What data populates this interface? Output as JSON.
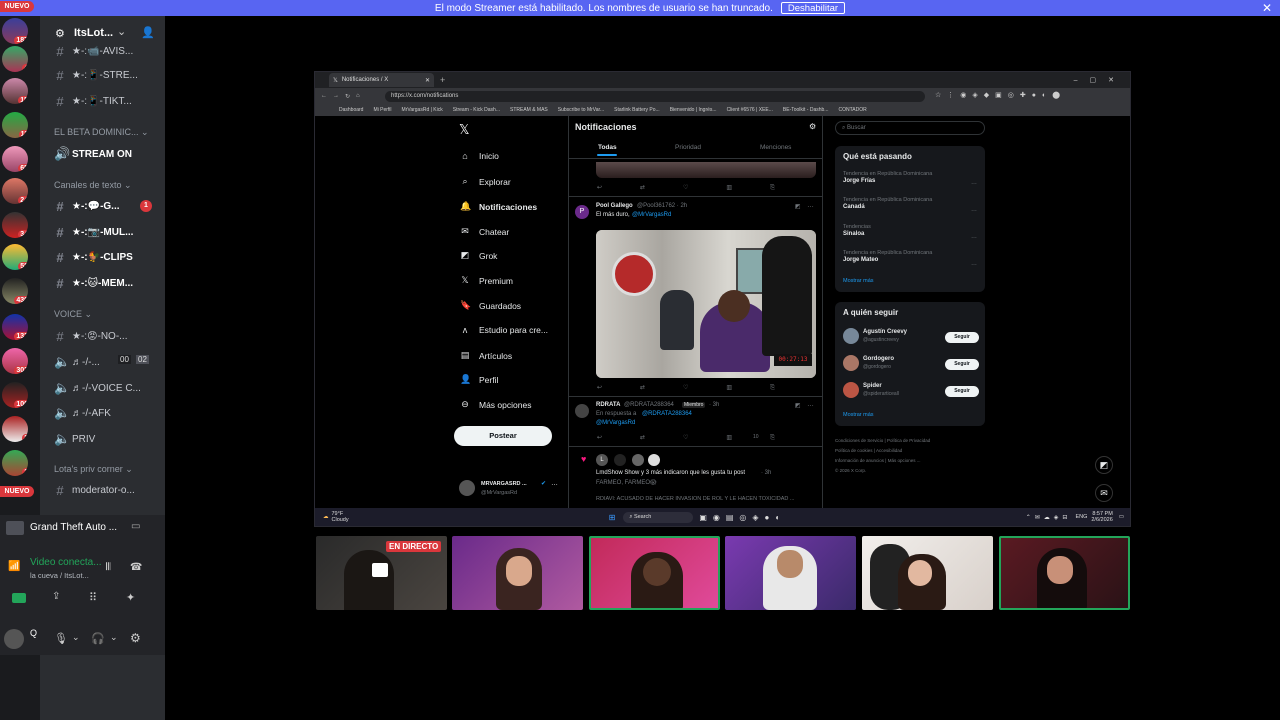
{
  "banner": {
    "text": "El modo Streamer está habilitado. Los nombres de usuario se han truncado.",
    "button": "Deshabilitar"
  },
  "server_rail": {
    "nuevo_top": "NUEVO",
    "nuevo_bottom": "NUEVO",
    "badges": [
      "187",
      "4",
      "15",
      "11",
      "65",
      "24",
      "34",
      "58",
      "430",
      "133",
      "303",
      "106",
      "2",
      "1"
    ]
  },
  "sidebar": {
    "server_name": "ItsLot...",
    "channels_top": [
      "★-:📹-AVIS...",
      "★-:📱-STRE...",
      "★-:📱-TIKT..."
    ],
    "category_beta": "EL BETA DOMINIC...",
    "stream_on": "STREAM ON",
    "category_text": "Canales de texto",
    "text_channels": [
      {
        "name": "★-:💬-G...",
        "badge": "1"
      },
      {
        "name": "★-:📷-MUL..."
      },
      {
        "name": "★-:🐓-CLIPS"
      },
      {
        "name": "★-:🐱-MEM..."
      }
    ],
    "category_voice": "VOICE",
    "voice_channels": [
      {
        "name": "★-:😡-NO-..."
      },
      {
        "name": "♬-/-...",
        "counts": [
          "00",
          "02"
        ]
      },
      {
        "name": "♬-/-VOICE C..."
      },
      {
        "name": "♬-/-AFK"
      },
      {
        "name": "PRIV"
      }
    ],
    "category_priv": "Lota's priv corner",
    "moderator": "moderator-o...",
    "activity": "Grand Theft Auto ...",
    "voice_connected": "Video conecta...",
    "voice_location": "la cueva / ItsLot...",
    "user_letter": "Q"
  },
  "browser": {
    "tab_title": "Notificaciones / X",
    "url": "https://x.com/notifications",
    "bookmarks": [
      "Dashboard",
      "Mi Perfil",
      "MrVargasRd | Kick",
      "Stream - Kick Dash...",
      "STREAM & MAS",
      "Subscribe to MrVar...",
      "Starlink Battery Po...",
      "Bienvenido | Ingrés...",
      "Client #6576 | XEE...",
      "BE-Toolkit - Dashb...",
      "CONTADOR"
    ]
  },
  "x": {
    "nav": [
      "Inicio",
      "Explorar",
      "Notificaciones",
      "Chatear",
      "Grok",
      "Premium",
      "Guardados",
      "Estudio para cre...",
      "Artículos",
      "Perfil",
      "Más opciones"
    ],
    "post_button": "Postear",
    "account_name": "MRVARGASRD ...",
    "account_handle": "@MrVargasRd",
    "header": "Notificaciones",
    "tabs": [
      "Todas",
      "Prioridad",
      "Menciones"
    ],
    "post1": {
      "author": "Pool Gallego",
      "handle": "@Pool361762 · 2h",
      "text": "El más duro,",
      "mention": "@MrVargasRd"
    },
    "post2": {
      "author": "RDRATA",
      "handle": "@RDRATA288364",
      "tag": "Miembro",
      "time": "· 3h",
      "reply_to_label": "En respuesta a",
      "reply_to": "@RDRATA288364",
      "mention": "@MrVargasRd",
      "views": "10"
    },
    "notif": {
      "text": "LmdShow Show y 3 más indicaron que les gusta tu post",
      "time": "· 3h",
      "sub": "FARMEO, FARMEO😱",
      "preview": "RDIAVI: ACUSADO DE HACER INVASION DE ROL Y LE HACEN TOXICIDAD ..."
    },
    "search_placeholder": "Buscar",
    "trending_title": "Qué está pasando",
    "trends": [
      {
        "context": "Tendencia en República Dominicana",
        "name": "Jorge Frías"
      },
      {
        "context": "Tendencia en República Dominicana",
        "name": "Canadá"
      },
      {
        "context": "Tendencias",
        "name": "Sinaloa"
      },
      {
        "context": "Tendencia en República Dominicana",
        "name": "Jorge Mateo"
      }
    ],
    "show_more": "Mostrar más",
    "follow_title": "A quién seguir",
    "follow": [
      {
        "name": "Agustín Creevy",
        "handle": "@agustincreevy"
      },
      {
        "name": "Gordogero",
        "handle": "@gordogero"
      },
      {
        "name": "Spider",
        "handle": "@spiderarticeall"
      }
    ],
    "follow_button": "Seguir",
    "follow_more": "Mostrar más",
    "footer": [
      "Condiciones de Servicio",
      "Política de Privacidad",
      "Política de cookies",
      "Accesibilidad",
      "Información de anuncios",
      "Más opciones ...",
      "© 2026 X Corp."
    ]
  },
  "taskbar": {
    "weather": "79°F",
    "weather_sub": "Cloudy",
    "search": "Search",
    "lang": "ENG",
    "time": "8:57 PM",
    "date": "2/6/2026"
  },
  "cams": {
    "live_label": "EN DIRECTO"
  }
}
